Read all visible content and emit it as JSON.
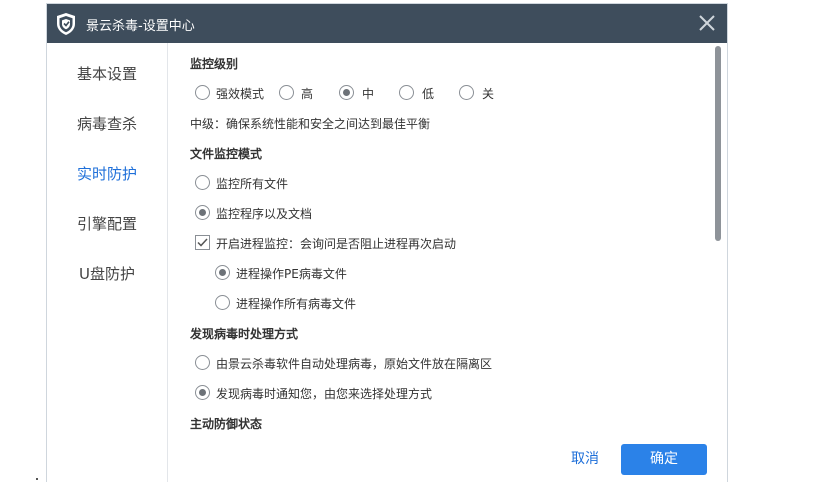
{
  "window": {
    "title": "景云杀毒-设置中心"
  },
  "sidebar": {
    "items": [
      {
        "label": "基本设置",
        "active": false
      },
      {
        "label": "病毒查杀",
        "active": false
      },
      {
        "label": "实时防护",
        "active": true
      },
      {
        "label": "引擎配置",
        "active": false
      },
      {
        "label": "U盘防护",
        "active": false
      }
    ]
  },
  "monitor_level": {
    "title": "监控级别",
    "options": [
      {
        "label": "强效模式",
        "checked": false
      },
      {
        "label": "高",
        "checked": false
      },
      {
        "label": "中",
        "checked": true
      },
      {
        "label": "低",
        "checked": false
      },
      {
        "label": "关",
        "checked": false
      }
    ],
    "description": "中级：确保系统性能和安全之间达到最佳平衡"
  },
  "file_monitor": {
    "title": "文件监控模式",
    "options": [
      {
        "label": "监控所有文件",
        "checked": false
      },
      {
        "label": "监控程序以及文档",
        "checked": true
      }
    ],
    "process_monitor": {
      "label": "开启进程监控：会询问是否阻止进程再次启动",
      "checked": true
    },
    "sub_options": [
      {
        "label": "进程操作PE病毒文件",
        "checked": true
      },
      {
        "label": "进程操作所有病毒文件",
        "checked": false
      }
    ]
  },
  "virus_handling": {
    "title": "发现病毒时处理方式",
    "options": [
      {
        "label": "由景云杀毒软件自动处理病毒，原始文件放在隔离区",
        "checked": false
      },
      {
        "label": "发现病毒时通知您，由您来选择处理方式",
        "checked": true
      }
    ]
  },
  "active_defense": {
    "title": "主动防御状态"
  },
  "footer": {
    "cancel_label": "取消",
    "ok_label": "确定"
  },
  "colors": {
    "titlebar": "#3e4d5c",
    "accent": "#1e6fd9",
    "ok_button": "#2b82e8"
  },
  "icons": {
    "logo": "shield-logo-icon",
    "close": "close-icon"
  }
}
